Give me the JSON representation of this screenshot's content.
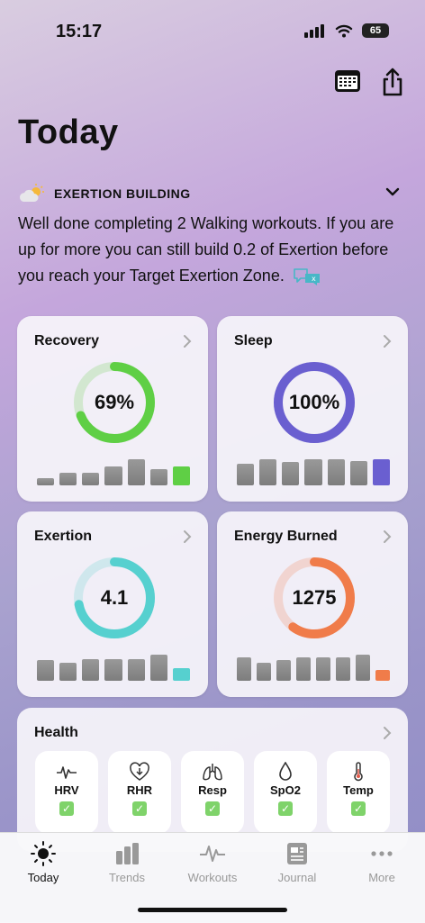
{
  "status_bar": {
    "time": "15:17",
    "battery": "65"
  },
  "page": {
    "title": "Today"
  },
  "insight": {
    "heading": "EXERTION BUILDING",
    "text": "Well done completing 2 Walking workouts. If you are up for more you can still build 0.2 of Exertion before you reach your Target Exertion Zone."
  },
  "cards": {
    "recovery": {
      "title": "Recovery",
      "value": "69%",
      "ring_fraction": 0.69,
      "color": "#5fcf45",
      "bars": [
        0.25,
        0.45,
        0.45,
        0.7,
        0.95,
        0.6,
        0.7
      ]
    },
    "sleep": {
      "title": "Sleep",
      "value": "100%",
      "ring_fraction": 1.0,
      "color": "#6a5fd0",
      "bars": [
        0.8,
        0.95,
        0.85,
        0.95,
        0.95,
        0.9,
        0.95
      ]
    },
    "exertion": {
      "title": "Exertion",
      "value": "4.1",
      "ring_fraction": 0.72,
      "color": "#56d0cf",
      "bars": [
        0.75,
        0.65,
        0.8,
        0.8,
        0.8,
        0.95,
        0.45
      ]
    },
    "energy": {
      "title": "Energy Burned",
      "value": "1275",
      "ring_fraction": 0.6,
      "color": "#f07c4a",
      "bars": [
        0.85,
        0.65,
        0.75,
        0.85,
        0.85,
        0.85,
        0.95,
        0.4
      ]
    }
  },
  "health": {
    "title": "Health",
    "metrics": [
      {
        "label": "HRV",
        "icon": "heartbeat-icon"
      },
      {
        "label": "RHR",
        "icon": "heart-down-icon"
      },
      {
        "label": "Resp",
        "icon": "lungs-icon"
      },
      {
        "label": "SpO2",
        "icon": "drop-icon"
      },
      {
        "label": "Temp",
        "icon": "thermometer-icon"
      }
    ]
  },
  "tabs": [
    {
      "label": "Today",
      "icon": "sun-icon"
    },
    {
      "label": "Trends",
      "icon": "bar-chart-icon"
    },
    {
      "label": "Workouts",
      "icon": "pulse-icon"
    },
    {
      "label": "Journal",
      "icon": "journal-icon"
    },
    {
      "label": "More",
      "icon": "ellipsis-icon"
    }
  ]
}
